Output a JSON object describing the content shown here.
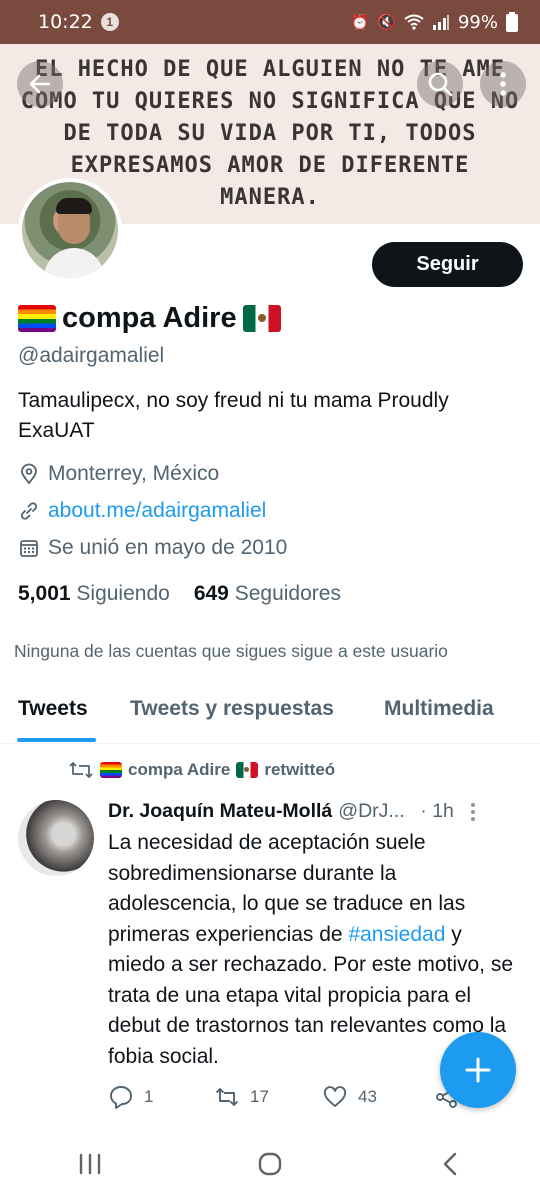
{
  "status_bar": {
    "time": "10:22",
    "notification_count": "1",
    "battery": "99%"
  },
  "banner": {
    "text": "EL HECHO DE QUE ALGUIEN NO TE AME COMO TU QUIERES NO SIGNIFICA QUE NO DE TODA SU VIDA POR TI, TODOS EXPRESAMOS AMOR DE DIFERENTE MANERA."
  },
  "profile": {
    "name": "compa Adire",
    "handle": "@adairgamaliel",
    "bio": "Tamaulipecx, no soy freud ni tu mama Proudly ExaUAT",
    "location": "Monterrey, México",
    "website": "about.me/adairgamaliel",
    "joined": "Se unió en mayo de 2010",
    "following_count": "5,001",
    "following_label": "Siguiendo",
    "followers_count": "649",
    "followers_label": "Seguidores",
    "mutual_note": "Ninguna de las cuentas que sigues sigue a este usuario",
    "follow_label": "Seguir"
  },
  "tabs": [
    {
      "label": "Tweets"
    },
    {
      "label": "Tweets y respuestas"
    },
    {
      "label": "Multimedia"
    }
  ],
  "tweet": {
    "retweeted_by_name": "compa Adire",
    "retweeted_suffix": "retwitteó",
    "author_name": "Dr. Joaquín Mateu-Mollá",
    "author_handle": "@DrJ...",
    "time": "· 1h",
    "text_before": "La necesidad de aceptación suele sobredimensionarse durante la adolescencia, lo que se traduce en las primeras experiencias de ",
    "hashtag": "#ansiedad",
    "text_after": " y miedo a ser rechazado. Por este motivo, se trata de una etapa vital propicia para el debut de trastornos tan relevantes como la fobia social.",
    "replies": "1",
    "retweets": "17",
    "likes": "43"
  },
  "colors": {
    "accent": "#1d9bf0",
    "status_bar": "#7a4a3e",
    "banner_bg": "#f3e9e5",
    "text_primary": "#0f1419",
    "text_secondary": "#536471"
  },
  "icons": [
    "back-arrow-icon",
    "search-icon",
    "more-vertical-icon",
    "location-pin-icon",
    "link-icon",
    "calendar-icon",
    "retweet-icon",
    "reply-icon",
    "like-icon",
    "share-icon",
    "compose-plus-icon",
    "recent-apps-icon",
    "home-icon",
    "nav-back-icon"
  ]
}
